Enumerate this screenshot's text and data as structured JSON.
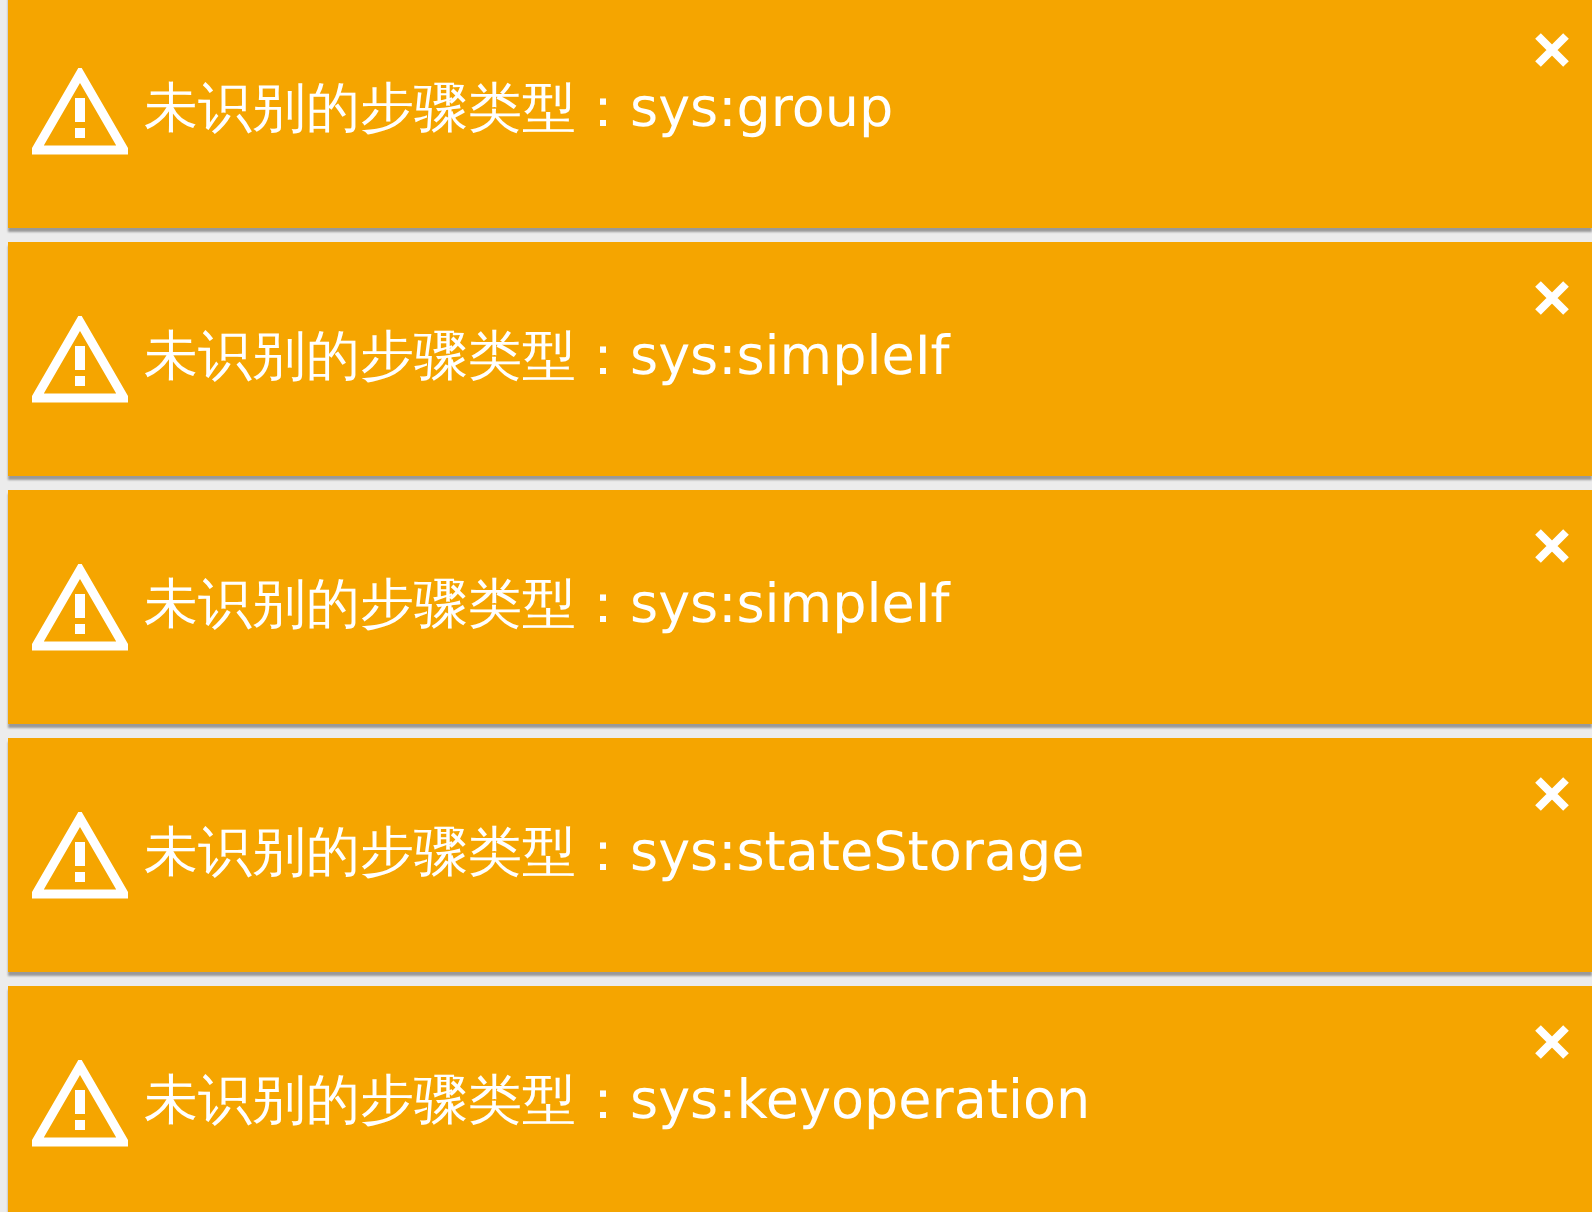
{
  "notifications": [
    {
      "kind": "warning",
      "message": "未识别的步骤类型：sys:group"
    },
    {
      "kind": "warning",
      "message": "未识别的步骤类型：sys:simpleIf"
    },
    {
      "kind": "warning",
      "message": "未识别的步骤类型：sys:simpleIf"
    },
    {
      "kind": "warning",
      "message": "未识别的步骤类型：sys:stateStorage"
    },
    {
      "kind": "warning",
      "message": "未识别的步骤类型：sys:keyoperation"
    }
  ]
}
